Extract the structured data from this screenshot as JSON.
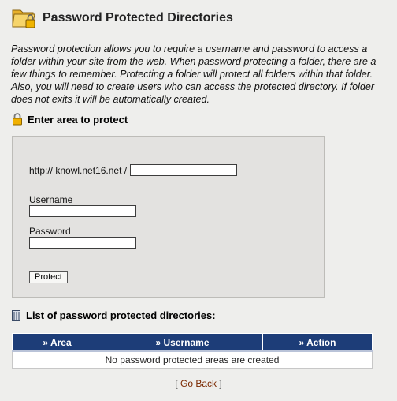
{
  "header": {
    "title": "Password Protected Directories"
  },
  "intro": "Password protection allows you to require a username and password to access a folder within your site from the web. When password protecting a folder, there are a few things to remember. Protecting a folder will protect all folders within that folder. Also, you will need to create users who can access the protected directory. If folder does not exits it will be automatically created.",
  "protect_section": {
    "title": "Enter area to protect",
    "url_prefix": "http:// knowl.net16.net /",
    "path_value": "",
    "username_label": "Username",
    "username_value": "",
    "password_label": "Password",
    "password_value": "",
    "protect_button": "Protect"
  },
  "list_section": {
    "title": "List of password protected directories:",
    "columns": [
      "» Area",
      "» Username",
      "» Action"
    ],
    "empty_message": "No password protected areas are created"
  },
  "footer": {
    "bracket_open": "[",
    "go_back": "Go Back",
    "bracket_close": "]"
  },
  "colors": {
    "table_header": "#1d3d78",
    "link": "#7a2800",
    "panel_bg": "#e3e2e0",
    "page_bg": "#eeeeec"
  },
  "icons": {
    "title": "folder-lock-icon",
    "protect_section": "padlock-icon",
    "list_section": "list-icon"
  }
}
